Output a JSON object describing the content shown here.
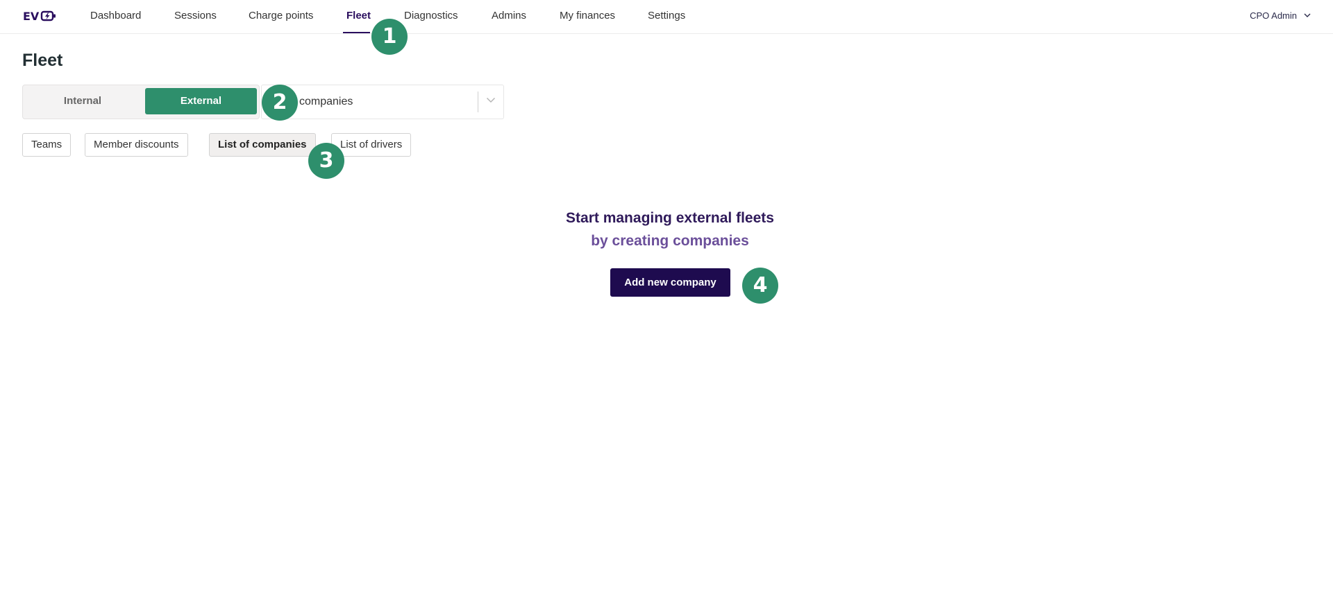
{
  "header": {
    "logo": {
      "text": "EV",
      "icon": "plug-bolt-icon"
    },
    "nav": [
      {
        "label": "Dashboard"
      },
      {
        "label": "Sessions"
      },
      {
        "label": "Charge points"
      },
      {
        "label": "Fleet",
        "active": true
      },
      {
        "label": "Diagnostics"
      },
      {
        "label": "Admins"
      },
      {
        "label": "My finances"
      },
      {
        "label": "Settings"
      }
    ],
    "user": {
      "label": "CPO Admin",
      "icon": "chevron-down-icon"
    }
  },
  "page": {
    "title": "Fleet",
    "toggle": {
      "internal": "Internal",
      "external": "External",
      "selected": "External"
    },
    "select": {
      "value": "companies",
      "icon": "chevron-down-icon"
    },
    "tabs": [
      {
        "label": "Teams"
      },
      {
        "label": "Member discounts"
      },
      {
        "label": "List of companies",
        "active": true
      },
      {
        "label": "List of drivers"
      }
    ],
    "empty_state": {
      "line1": "Start managing external fleets",
      "line2": "by creating companies",
      "button": "Add new company"
    }
  },
  "annotations": [
    {
      "label": "1"
    },
    {
      "label": "2"
    },
    {
      "label": "3"
    },
    {
      "label": "4"
    }
  ],
  "colors": {
    "brand": "#2a0e5e",
    "accent_green": "#2e8f6c",
    "button_dark": "#1e0b4f"
  }
}
